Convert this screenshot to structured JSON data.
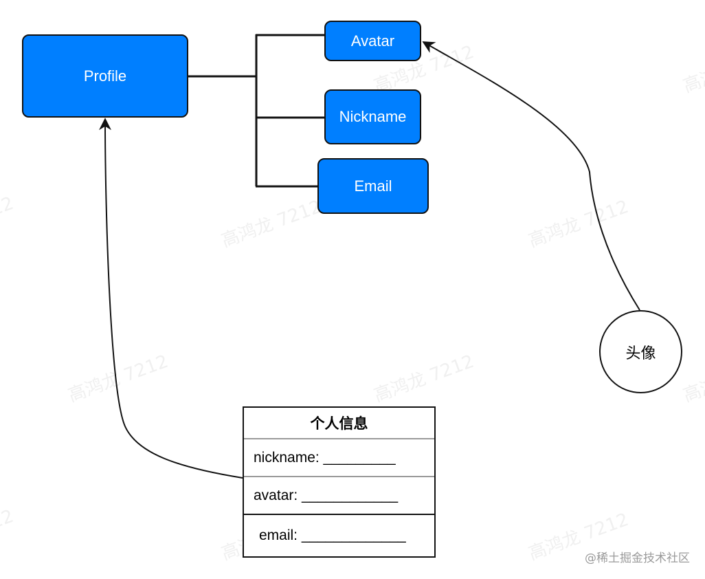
{
  "watermark": "高鸿龙 7212",
  "nodes": {
    "profile": "Profile",
    "avatar": "Avatar",
    "nickname": "Nickname",
    "email": "Email"
  },
  "circle": {
    "label": "头像"
  },
  "form": {
    "title": "个人信息",
    "rows": [
      {
        "label": "nickname: _________"
      },
      {
        "label": "avatar: ____________"
      },
      {
        "label": "email: _____________"
      }
    ]
  },
  "footer": "@稀土掘金技术社区",
  "colors": {
    "node_fill": "#007fff",
    "stroke": "#111111"
  }
}
